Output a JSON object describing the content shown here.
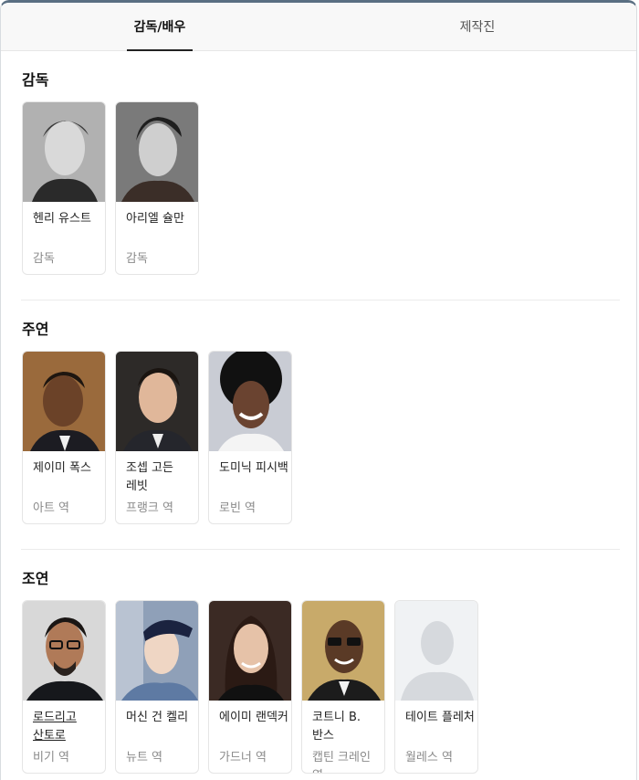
{
  "tabs": [
    {
      "label": "감독/배우",
      "active": true
    },
    {
      "label": "제작진",
      "active": false
    }
  ],
  "sections": {
    "director": {
      "title": "감독",
      "people": [
        {
          "name": "헨리 유스트",
          "role": "감독"
        },
        {
          "name": "아리엘 슐만",
          "role": "감독"
        }
      ]
    },
    "lead": {
      "title": "주연",
      "people": [
        {
          "name": "제이미 폭스",
          "role": "아트 역"
        },
        {
          "name": "조셉 고든 레빗",
          "role": "프랭크 역"
        },
        {
          "name": "도미닉 피시백",
          "role": "로빈 역"
        }
      ]
    },
    "supporting": {
      "title": "조연",
      "people": [
        {
          "name": "로드리고 산토로",
          "role": "비기 역"
        },
        {
          "name": "머신 건 켈리",
          "role": "뉴트 역"
        },
        {
          "name": "에이미 랜덱커",
          "role": "가드너 역"
        },
        {
          "name": "코트니 B. 반스",
          "role": "캡틴 크레인 역"
        },
        {
          "name": "테이트 플레처",
          "role": "월레스 역"
        }
      ]
    }
  },
  "colors": {
    "accent_border": "#5a6f82",
    "placeholder_bg": "#f0f2f4",
    "placeholder_silhouette": "#d6d9dd"
  }
}
